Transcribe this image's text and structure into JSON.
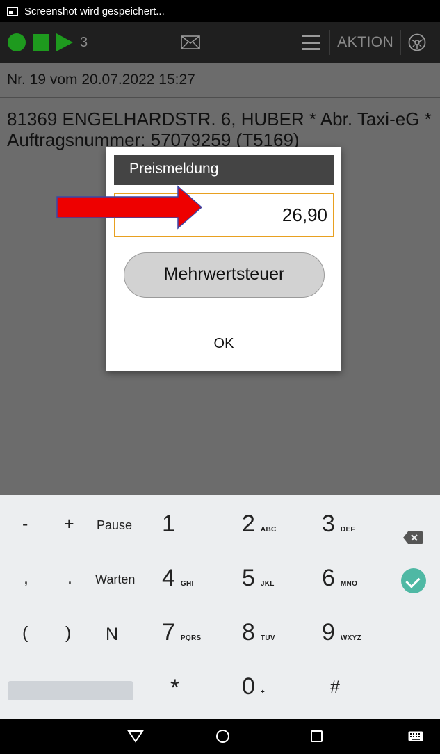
{
  "status_bar": {
    "notification": "Screenshot wird gespeichert..."
  },
  "toolbar": {
    "count": "3",
    "action_label": "AKTION",
    "status_color": "#1e9a1e"
  },
  "order": {
    "header": "Nr. 19 vom 20.07.2022 15:27",
    "address": "81369 ENGELHARDSTR. 6, HUBER * Abr. Taxi-eG * Auftragsnummer: 57079259 (T5169)"
  },
  "dialog": {
    "title": "Preismeldung",
    "price_value": "26,90",
    "vat_button": "Mehrwertsteuer",
    "ok_button": "OK",
    "accent_color": "#e8a020"
  },
  "keyboard": {
    "row1": {
      "minus": "-",
      "plus": "+",
      "pause": "Pause",
      "k1": "1",
      "k2": "2",
      "k2_sub": "ABC",
      "k3": "3",
      "k3_sub": "DEF"
    },
    "row2": {
      "comma": ",",
      "period": ".",
      "wait": "Warten",
      "k4": "4",
      "k4_sub": "GHI",
      "k5": "5",
      "k5_sub": "JKL",
      "k6": "6",
      "k6_sub": "MNO"
    },
    "row3": {
      "open_paren": "(",
      "close_paren": ")",
      "n": "N",
      "k7": "7",
      "k7_sub": "PQRS",
      "k8": "8",
      "k8_sub": "TUV",
      "k9": "9",
      "k9_sub": "WXYZ"
    },
    "row4": {
      "star": "*",
      "k0": "0",
      "k0_sub": "+",
      "hash": "#"
    },
    "done_color": "#4fb8a4"
  },
  "annotation": {
    "arrow_color": "#ee0000"
  }
}
